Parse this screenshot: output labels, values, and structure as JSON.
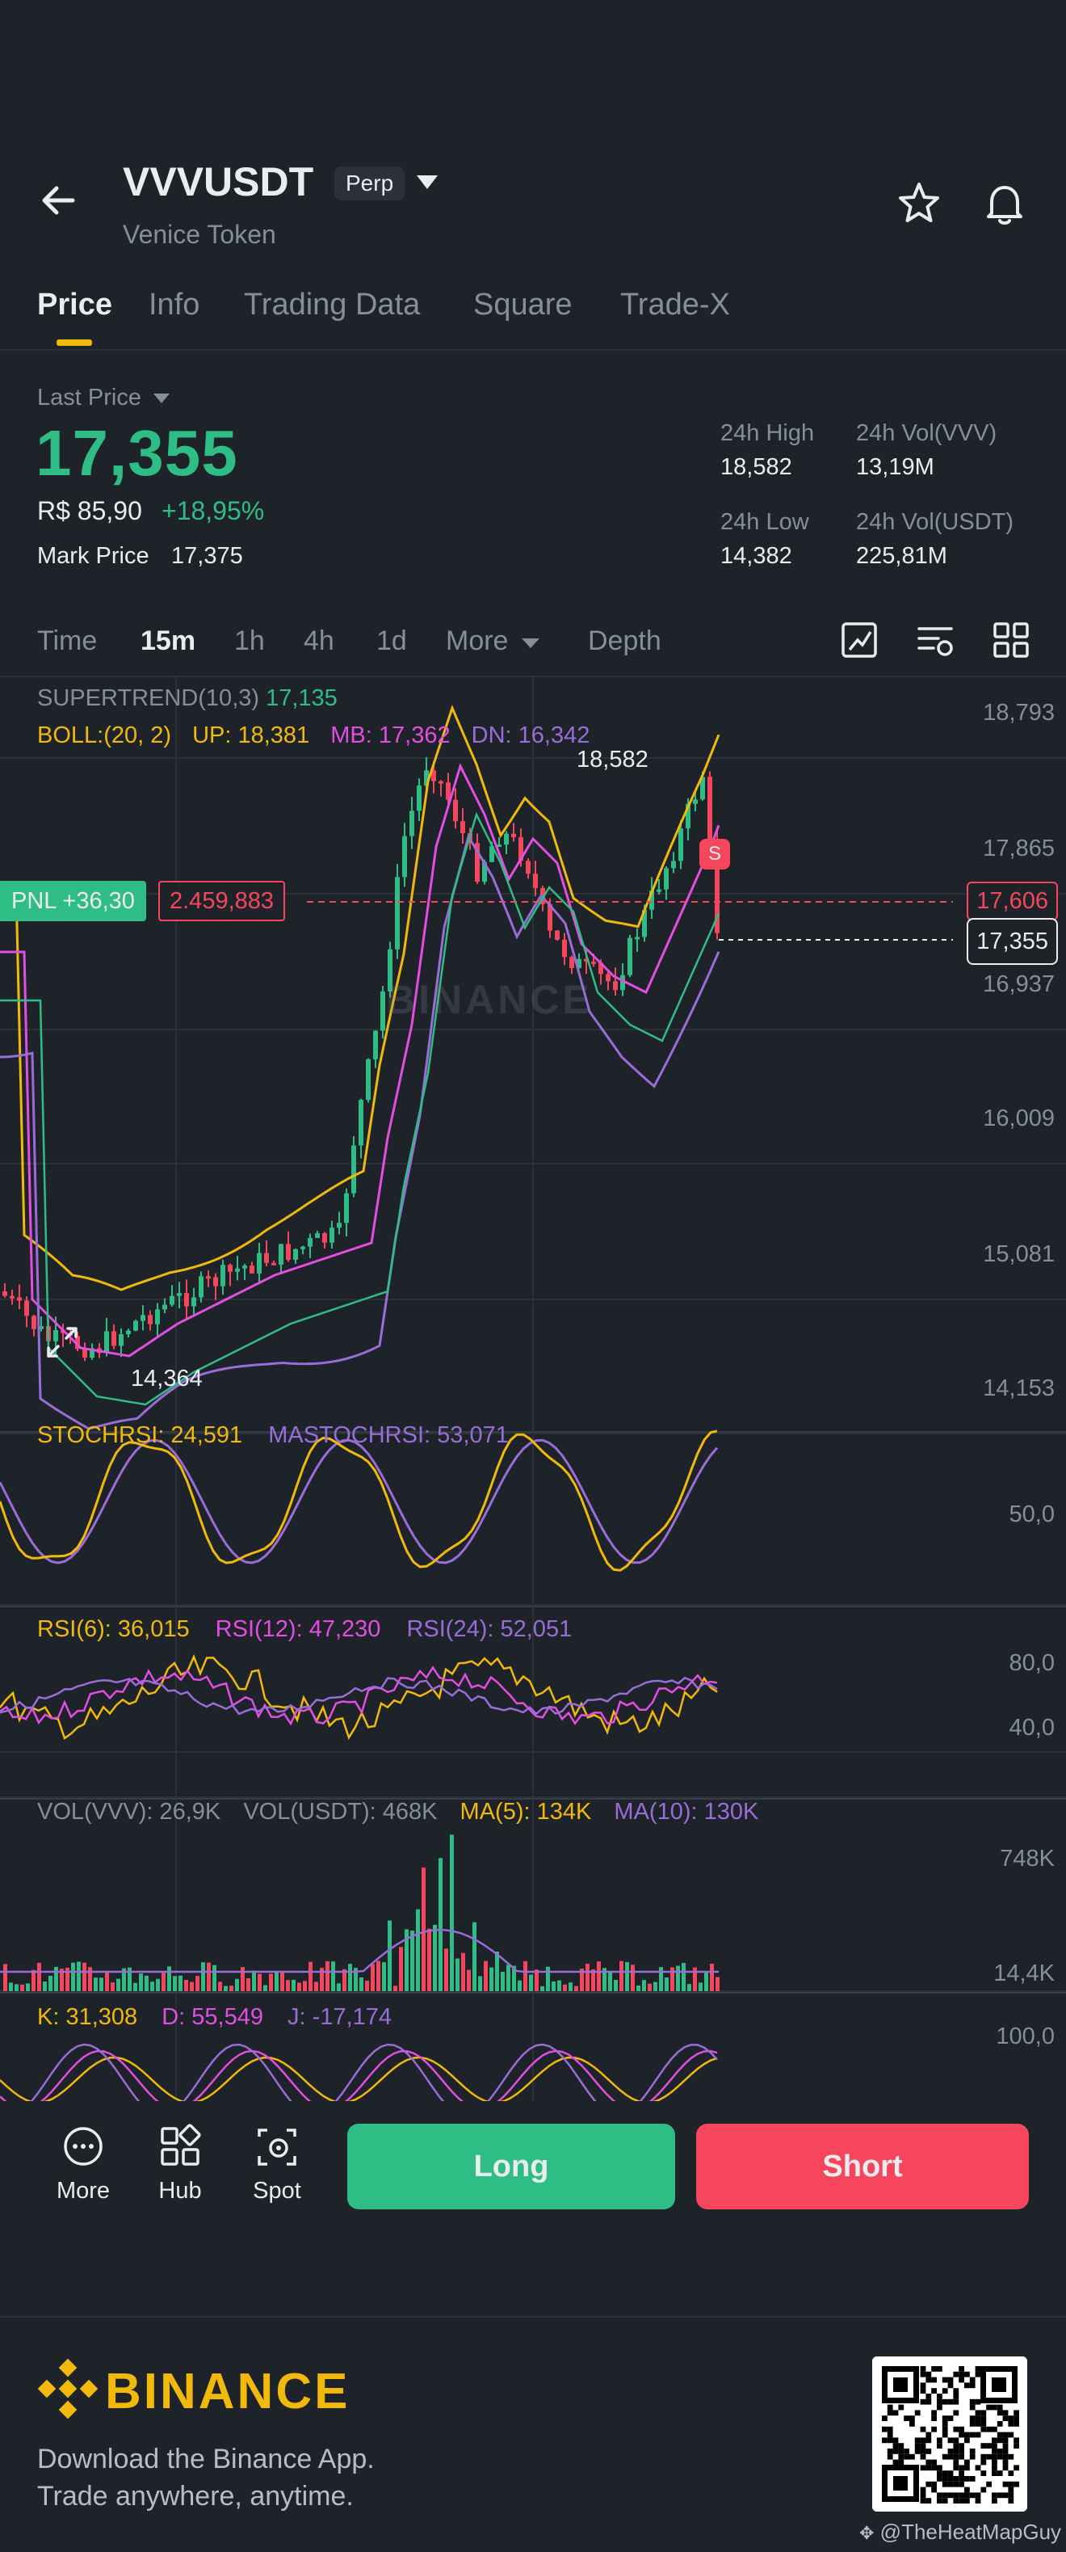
{
  "header": {
    "symbol": "VVVUSDT",
    "badge": "Perp",
    "name": "Venice Token"
  },
  "tabs": [
    "Price",
    "Info",
    "Trading Data",
    "Square",
    "Trade-X"
  ],
  "price": {
    "last_label": "Last Price",
    "last": "17,355",
    "brl": "R$ 85,90",
    "change": "+18,95%",
    "mark_label": "Mark Price",
    "mark": "17,375"
  },
  "stats": {
    "high_label": "24h High",
    "high": "18,582",
    "vol_vvv_label": "24h Vol(VVV)",
    "vol_vvv": "13,19M",
    "low_label": "24h Low",
    "low": "14,382",
    "vol_usdt_label": "24h Vol(USDT)",
    "vol_usdt": "225,81M"
  },
  "intervals": [
    "Time",
    "15m",
    "1h",
    "4h",
    "1d",
    "More",
    "Depth"
  ],
  "chart": {
    "supertrend_label": "SUPERTREND(10,3)",
    "supertrend_value": "17,135",
    "boll_label": "BOLL:(20, 2)",
    "boll_up": "UP: 18,381",
    "boll_mb": "MB: 17,362",
    "boll_dn": "DN: 16,342",
    "high_marker": "18,582",
    "low_marker": "14,364",
    "pnl_label": "PNL +36,30",
    "position_price": "2.459,883",
    "entry_price": "17,606",
    "current_price": "17,355",
    "sell_marker": "S",
    "watermark": "BINANCE",
    "price_axis": [
      "18,793",
      "17,865",
      "16,937",
      "16,009",
      "15,081",
      "14,153"
    ],
    "stoch_label": "STOCHRSI: 24,591",
    "mastoch_label": "MASTOCHRSI: 53,071",
    "stoch_axis": [
      "50,0"
    ],
    "rsi6": "RSI(6): 36,015",
    "rsi12": "RSI(12): 47,230",
    "rsi24": "RSI(24): 52,051",
    "rsi_axis": [
      "80,0",
      "40,0"
    ],
    "vol_vvv": "VOL(VVV): 26,9K",
    "vol_usdt": "VOL(USDT): 468K",
    "ma5": "MA(5): 134K",
    "ma10": "MA(10): 130K",
    "vol_axis": [
      "748K",
      "14,4K"
    ],
    "k": "K: 31,308",
    "d": "D: 55,549",
    "j": "J: -17,174",
    "kdj_axis": [
      "100,0"
    ]
  },
  "bottom": {
    "more": "More",
    "hub": "Hub",
    "spot": "Spot",
    "long": "Long",
    "short": "Short"
  },
  "footer": {
    "brand": "BINANCE",
    "line1": "Download the Binance App.",
    "line2": "Trade anywhere, anytime.",
    "credit": "@TheHeatMapGuy"
  },
  "colors": {
    "up": "#2ebd85",
    "down": "#f6465d",
    "accent": "#f0b90b",
    "boll_up": "#f0b90b",
    "boll_mb": "#e14ee1",
    "boll_dn": "#9a6cd8"
  }
}
